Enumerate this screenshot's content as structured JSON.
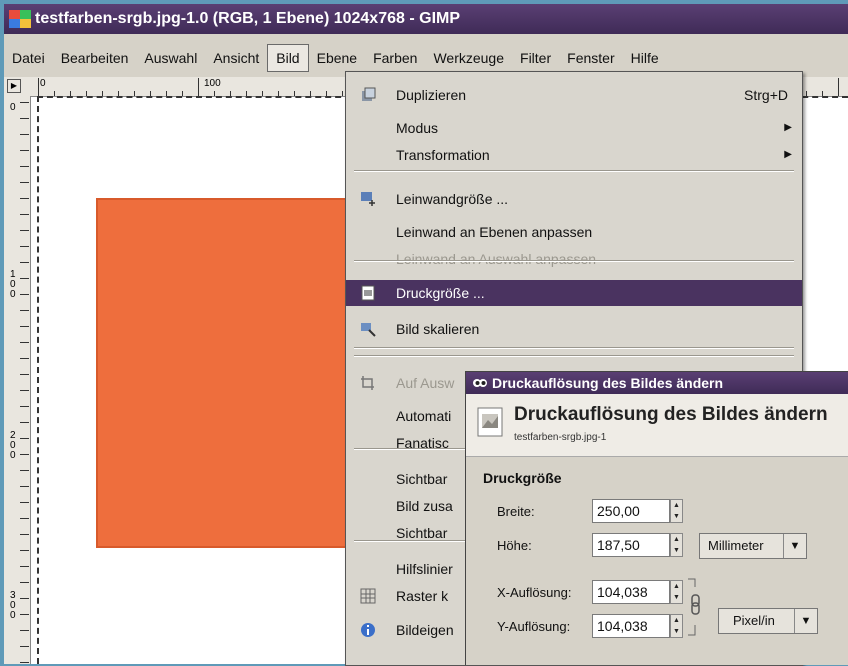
{
  "window": {
    "title": "testfarben-srgb.jpg-1.0 (RGB, 1 Ebene) 1024x768 - GIMP"
  },
  "menubar": [
    "Datei",
    "Bearbeiten",
    "Auswahl",
    "Ansicht",
    "Bild",
    "Ebene",
    "Farben",
    "Werkzeuge",
    "Filter",
    "Fenster",
    "Hilfe"
  ],
  "ruler": {
    "h_labels": [
      "0",
      "100"
    ],
    "v_labels": [
      "1\n0\n0",
      "2\n0\n0",
      "3\n0\n0"
    ]
  },
  "colors": {
    "accent": "#4a3360",
    "canvas_rect": "#ee6e3d",
    "title_bar": "#4a3360"
  },
  "bild_menu": {
    "items": [
      {
        "label": "Duplizieren",
        "shortcut": "Strg+D",
        "icon": "duplicate-icon"
      },
      {
        "label": "Modus",
        "submenu": true
      },
      {
        "label": "Transformation",
        "submenu": true
      },
      {
        "label": "Leinwandgröße ...",
        "icon": "canvas-size-icon"
      },
      {
        "label": "Leinwand an Ebenen anpassen"
      },
      {
        "label": "Leinwand an Auswahl anpassen",
        "disabled": true
      },
      {
        "label": "Druckgröße ...",
        "icon": "print-size-icon",
        "highlighted": true
      },
      {
        "label": "Bild skalieren",
        "icon": "scale-icon"
      },
      {
        "label": "Auf Ausw",
        "icon": "crop-icon",
        "disabled": true
      },
      {
        "label": "Automati"
      },
      {
        "label": "Fanatisc"
      },
      {
        "label": "Sichtbar"
      },
      {
        "label": "Bild zusa"
      },
      {
        "label": "Sichtbar"
      },
      {
        "label": "Hilfslinier"
      },
      {
        "label": "Raster k",
        "icon": "grid-icon"
      },
      {
        "label": "Bildeigen",
        "icon": "info-icon"
      }
    ]
  },
  "dialog": {
    "window_title": "Druckauflösung des Bildes ändern",
    "header_title": "Druckauflösung des Bildes ändern",
    "header_subtitle": "testfarben-srgb.jpg-1",
    "section": "Druckgröße",
    "width_label": "Breite:",
    "width_value": "250,00",
    "height_label": "Höhe:",
    "height_value": "187,50",
    "unit": "Millimeter",
    "xres_label": "X-Auflösung:",
    "xres_value": "104,038",
    "yres_label": "Y-Auflösung:",
    "yres_value": "104,038",
    "res_unit": "Pixel/in"
  }
}
